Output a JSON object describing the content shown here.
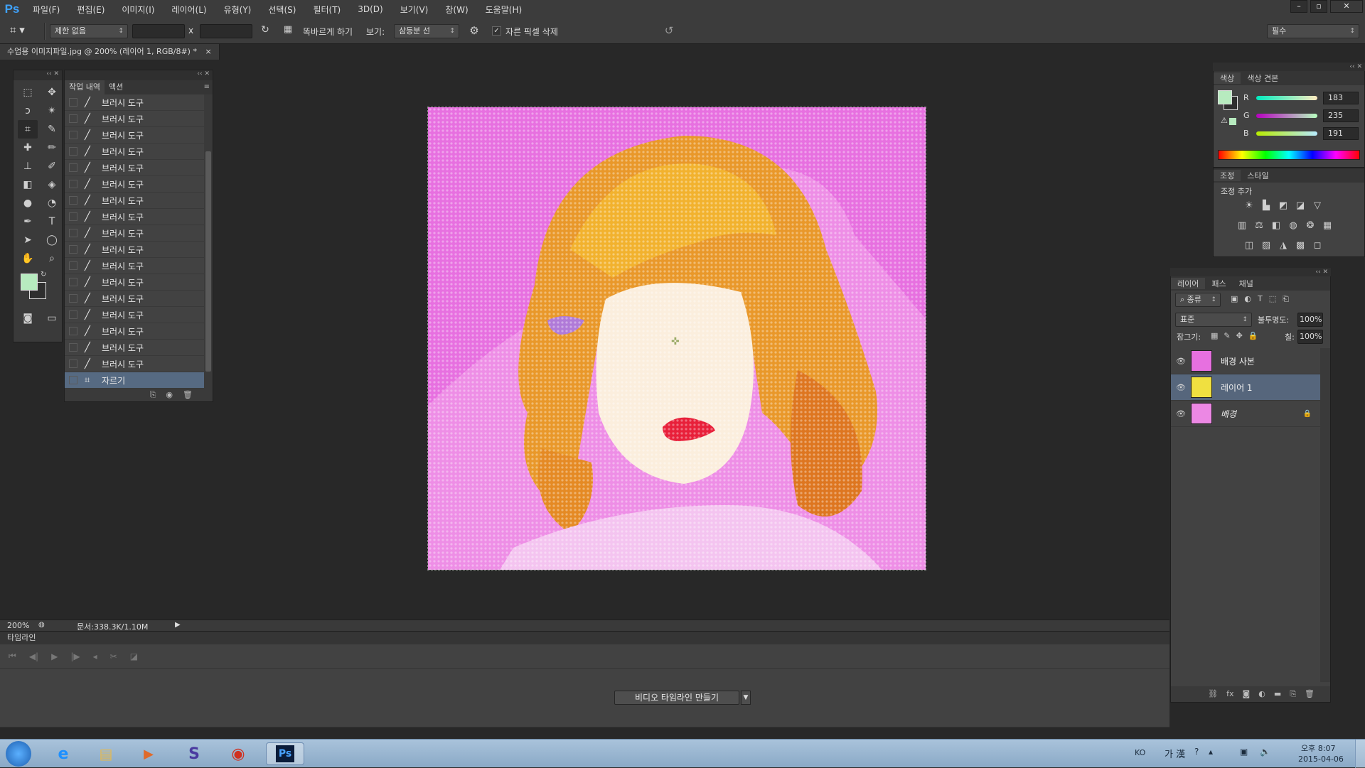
{
  "app": {
    "logo": "Ps",
    "menu": [
      "파일(F)",
      "편집(E)",
      "이미지(I)",
      "레이어(L)",
      "유형(Y)",
      "선택(S)",
      "필터(T)",
      "3D(D)",
      "보기(V)",
      "창(W)",
      "도움말(H)"
    ],
    "window_buttons": [
      "–",
      "▫",
      "✕"
    ]
  },
  "options": {
    "ratio_select": "제한 없음",
    "width_value": "",
    "x_sep": "x",
    "height_value": "",
    "straighten_label": "똑바르게 하기",
    "view_label": "보기:",
    "view_select": "삼등분 선",
    "delete_cropped_label": "자른 픽셀 삭제",
    "delete_cropped_checked": true,
    "workspace_select": "필수"
  },
  "document": {
    "tab_title": "수업용 이미지파일.jpg @ 200% (레이어 1, RGB/8#) *",
    "close": "×"
  },
  "history": {
    "tabs": [
      "작업 내역",
      "액션"
    ],
    "items": [
      "브러시 도구",
      "브러시 도구",
      "브러시 도구",
      "브러시 도구",
      "브러시 도구",
      "브러시 도구",
      "브러시 도구",
      "브러시 도구",
      "브러시 도구",
      "브러시 도구",
      "브러시 도구",
      "브러시 도구",
      "브러시 도구",
      "브러시 도구",
      "브러시 도구",
      "브러시 도구",
      "브러시 도구"
    ],
    "selected_item": "자르기"
  },
  "color_panel": {
    "tabs": [
      "색상",
      "색상 견본"
    ],
    "labels": [
      "R",
      "G",
      "B"
    ],
    "values": [
      "183",
      "235",
      "191"
    ],
    "foreground": "#b7ebbf"
  },
  "adjustments_panel": {
    "tabs": [
      "조정",
      "스타일"
    ],
    "heading": "조정 추가"
  },
  "layers_panel": {
    "tabs": [
      "레이어",
      "패스",
      "채널"
    ],
    "filter_select": "종류",
    "blend_mode": "표준",
    "opacity_label": "불투명도:",
    "opacity_value": "100%",
    "lock_label": "잠그기:",
    "fill_label": "칠:",
    "fill_value": "100%",
    "layers": [
      {
        "name": "배경 사본",
        "selected": false,
        "locked": false
      },
      {
        "name": "레이어 1",
        "selected": true,
        "locked": false
      },
      {
        "name": "배경",
        "selected": false,
        "locked": true
      }
    ]
  },
  "status": {
    "zoom": "200%",
    "doc_info": "문서:338.3K/1.10M"
  },
  "timeline": {
    "title": "타임라인",
    "create_button": "비디오 타임라인 만들기"
  },
  "taskbar": {
    "lang": "KO",
    "ime": "가 漢",
    "time": "오후 8:07",
    "date": "2015-04-06"
  }
}
